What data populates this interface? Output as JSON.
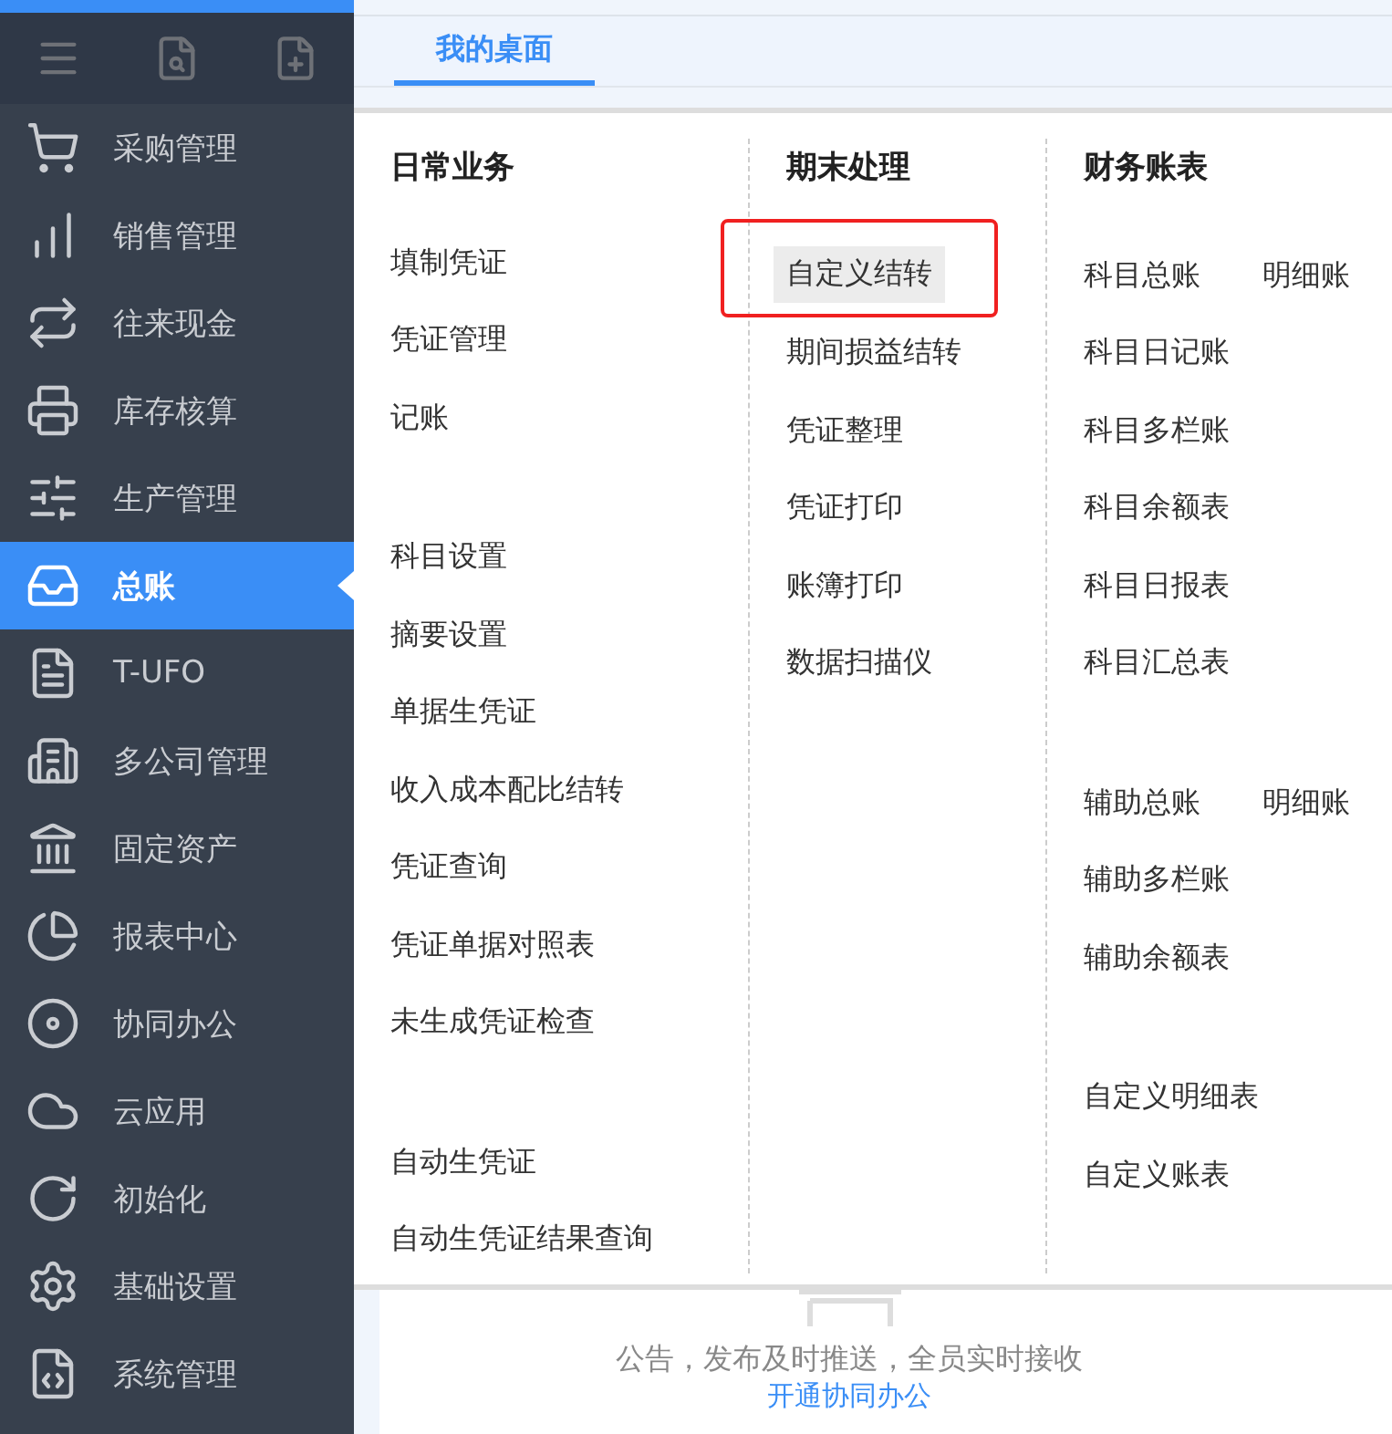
{
  "sidebar": {
    "items": [
      {
        "label": "采购管理",
        "selected": false
      },
      {
        "label": "销售管理",
        "selected": false
      },
      {
        "label": "往来现金",
        "selected": false
      },
      {
        "label": "库存核算",
        "selected": false
      },
      {
        "label": "生产管理",
        "selected": false
      },
      {
        "label": "总账",
        "selected": true
      },
      {
        "label": "T-UFO",
        "selected": false
      },
      {
        "label": "多公司管理",
        "selected": false
      },
      {
        "label": "固定资产",
        "selected": false
      },
      {
        "label": "报表中心",
        "selected": false
      },
      {
        "label": "协同办公",
        "selected": false
      },
      {
        "label": "云应用",
        "selected": false
      },
      {
        "label": "初始化",
        "selected": false
      },
      {
        "label": "基础设置",
        "selected": false
      },
      {
        "label": "系统管理",
        "selected": false
      }
    ]
  },
  "tabs": [
    {
      "label": "我的桌面",
      "selected": true
    }
  ],
  "menu": {
    "columns": [
      {
        "title": "日常业务",
        "groups": [
          {
            "rows": [
              {
                "items": [
                  {
                    "label": "填制凭证",
                    "highlighted": false
                  }
                ]
              },
              {
                "items": [
                  {
                    "label": "凭证管理",
                    "highlighted": false
                  }
                ]
              },
              {
                "items": [
                  {
                    "label": "记账",
                    "highlighted": false
                  }
                ]
              }
            ]
          },
          {
            "rows": [
              {
                "items": [
                  {
                    "label": "科目设置",
                    "highlighted": false
                  }
                ]
              },
              {
                "items": [
                  {
                    "label": "摘要设置",
                    "highlighted": false
                  }
                ]
              },
              {
                "items": [
                  {
                    "label": "单据生凭证",
                    "highlighted": false
                  }
                ]
              },
              {
                "items": [
                  {
                    "label": "收入成本配比结转",
                    "highlighted": false
                  }
                ]
              },
              {
                "items": [
                  {
                    "label": "凭证查询",
                    "highlighted": false
                  }
                ]
              },
              {
                "items": [
                  {
                    "label": "凭证单据对照表",
                    "highlighted": false
                  }
                ]
              },
              {
                "items": [
                  {
                    "label": "未生成凭证检查",
                    "highlighted": false
                  }
                ]
              }
            ]
          },
          {
            "rows": [
              {
                "items": [
                  {
                    "label": "自动生凭证",
                    "highlighted": false
                  }
                ]
              },
              {
                "items": [
                  {
                    "label": "自动生凭证结果查询",
                    "highlighted": false
                  }
                ]
              }
            ]
          }
        ]
      },
      {
        "title": "期末处理",
        "groups": [
          {
            "rows": [
              {
                "items": [
                  {
                    "label": "自定义结转",
                    "highlighted": true
                  }
                ]
              },
              {
                "items": [
                  {
                    "label": "期间损益结转",
                    "highlighted": false
                  }
                ]
              },
              {
                "items": [
                  {
                    "label": "凭证整理",
                    "highlighted": false
                  }
                ]
              },
              {
                "items": [
                  {
                    "label": "凭证打印",
                    "highlighted": false
                  }
                ]
              },
              {
                "items": [
                  {
                    "label": "账簿打印",
                    "highlighted": false
                  }
                ]
              },
              {
                "items": [
                  {
                    "label": "数据扫描仪",
                    "highlighted": false
                  }
                ]
              }
            ]
          }
        ]
      },
      {
        "title": "财务账表",
        "groups": [
          {
            "rows": [
              {
                "items": [
                  {
                    "label": "科目总账",
                    "highlighted": false
                  },
                  {
                    "label": "明细账",
                    "highlighted": false
                  }
                ]
              },
              {
                "items": [
                  {
                    "label": "科目日记账",
                    "highlighted": false
                  }
                ]
              },
              {
                "items": [
                  {
                    "label": "科目多栏账",
                    "highlighted": false
                  }
                ]
              },
              {
                "items": [
                  {
                    "label": "科目余额表",
                    "highlighted": false
                  }
                ]
              },
              {
                "items": [
                  {
                    "label": "科目日报表",
                    "highlighted": false
                  }
                ]
              },
              {
                "items": [
                  {
                    "label": "科目汇总表",
                    "highlighted": false
                  }
                ]
              }
            ]
          },
          {
            "rows": [
              {
                "items": [
                  {
                    "label": "辅助总账",
                    "highlighted": false
                  },
                  {
                    "label": "明细账",
                    "highlighted": false
                  }
                ]
              },
              {
                "items": [
                  {
                    "label": "辅助多栏账",
                    "highlighted": false
                  }
                ]
              },
              {
                "items": [
                  {
                    "label": "辅助余额表",
                    "highlighted": false
                  }
                ]
              }
            ]
          },
          {
            "rows": [
              {
                "items": [
                  {
                    "label": "自定义明细表",
                    "highlighted": false
                  }
                ]
              },
              {
                "items": [
                  {
                    "label": "自定义账表",
                    "highlighted": false
                  }
                ]
              }
            ]
          }
        ]
      }
    ]
  },
  "notice": {
    "text": "公告，发布及时推送，全员实时接收",
    "link": "开通协同办公"
  }
}
